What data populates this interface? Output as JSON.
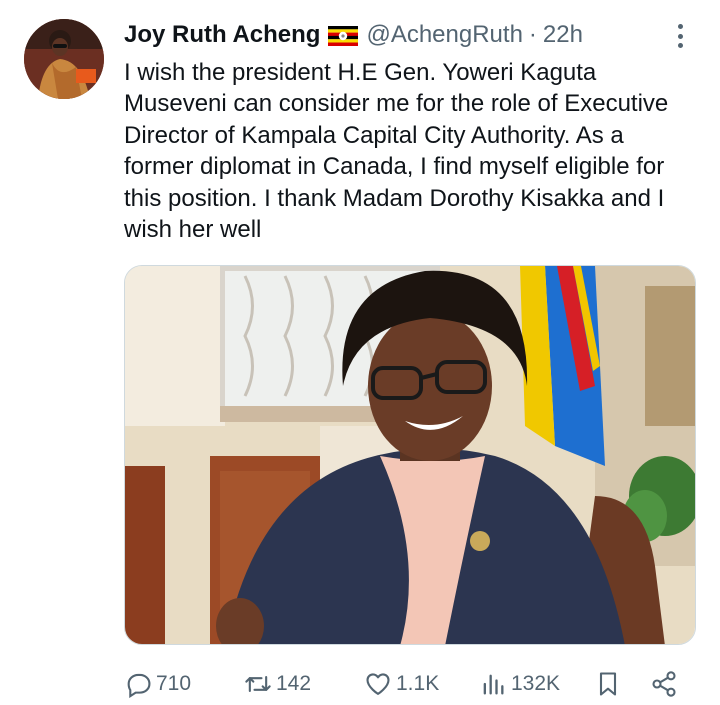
{
  "tweet": {
    "author_name": "Joy Ruth Acheng",
    "flag_icon": "uganda-flag-icon",
    "handle": "@AchengRuth",
    "separator": "·",
    "time": "22h",
    "text": "I wish the president H.E Gen. Yoweri Kaguta Museveni can consider me for the role of Executive Director of Kampala Capital City Authority. As a former diplomat in Canada, I find myself eligible for this position. I thank Madam Dorothy Kisakka and I wish her well"
  },
  "media": {
    "alt_subject": "photo"
  },
  "actions": {
    "replies": "710",
    "reposts": "142",
    "likes": "1.1K",
    "views": "132K"
  },
  "colors": {
    "text": "#0f1419",
    "muted": "#536471",
    "border": "#cfd9de"
  }
}
